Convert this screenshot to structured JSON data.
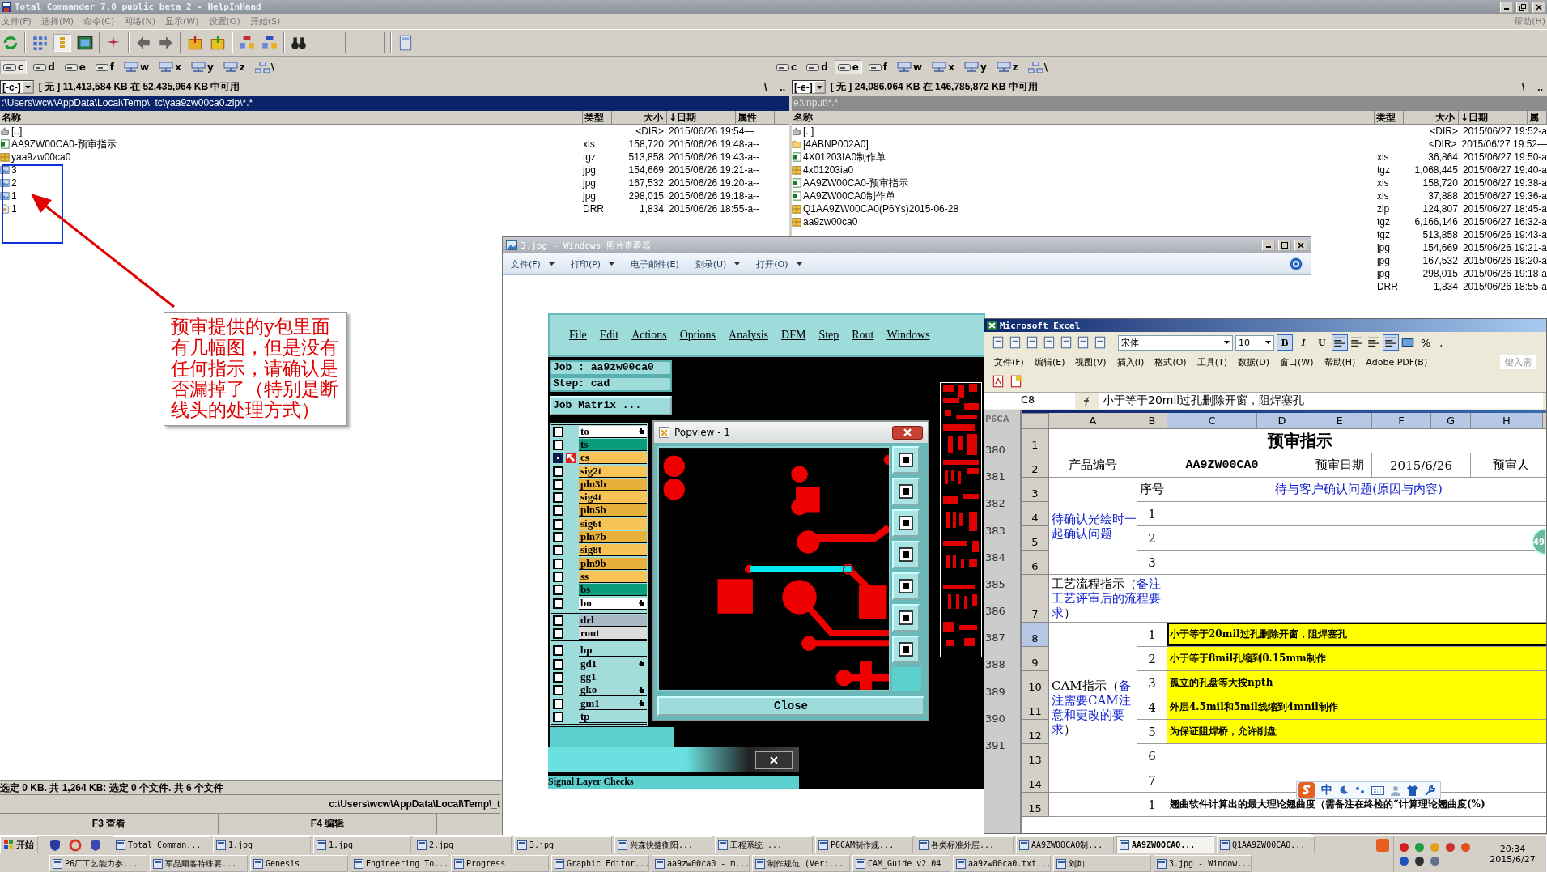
{
  "tc": {
    "title": "Total Commander 7.0 public beta 2 - HelpInHand",
    "menu": [
      "文件(F)",
      "选择(M)",
      "命令(C)",
      "网络(N)",
      "显示(W)",
      "设置(O)",
      "开始(S)"
    ],
    "help_menu": "帮助(H)",
    "drives_left": [
      {
        "letter": "c",
        "kind": "disk",
        "selected": true
      },
      {
        "letter": "d",
        "kind": "disk",
        "selected": false
      },
      {
        "letter": "e",
        "kind": "disk",
        "selected": false
      },
      {
        "letter": "f",
        "kind": "disk",
        "selected": false
      },
      {
        "letter": "w",
        "kind": "network",
        "selected": false
      },
      {
        "letter": "x",
        "kind": "network",
        "selected": false
      },
      {
        "letter": "y",
        "kind": "network",
        "selected": false
      },
      {
        "letter": "z",
        "kind": "network",
        "selected": false
      },
      {
        "letter": "\\",
        "kind": "root",
        "selected": false
      }
    ],
    "drives_right": [
      {
        "letter": "c",
        "kind": "disk",
        "selected": false
      },
      {
        "letter": "d",
        "kind": "disk",
        "selected": false
      },
      {
        "letter": "e",
        "kind": "disk",
        "selected": true
      },
      {
        "letter": "f",
        "kind": "disk",
        "selected": false
      },
      {
        "letter": "w",
        "kind": "network",
        "selected": false
      },
      {
        "letter": "x",
        "kind": "network",
        "selected": false
      },
      {
        "letter": "y",
        "kind": "network",
        "selected": false
      },
      {
        "letter": "z",
        "kind": "network",
        "selected": false
      },
      {
        "letter": "\\",
        "kind": "root",
        "selected": false
      }
    ],
    "left_panel": {
      "drive": "[-c-]",
      "free": "[ 无 ]  11,413,584 KB 在 52,435,964 KB 中可用",
      "root_button": "\\",
      "up_button": "..",
      "path": ":\\Users\\wcw\\AppData\\Local\\Temp\\_tc\\yaa9zw00ca0.zip\\*.*",
      "active": true,
      "columns": [
        "名称",
        "类型",
        "大小",
        "↓日期",
        "属性"
      ],
      "rows": [
        {
          "kind": "up",
          "name": "[..]",
          "size": "<DIR>",
          "date": "2015/06/26 19:54—"
        },
        {
          "kind": "xls",
          "name": "AA9ZW00CA0-预审指示",
          "type": "xls",
          "size": "158,720",
          "date": "2015/06/26 19:48-a--"
        },
        {
          "kind": "archive",
          "name": "yaa9zw00ca0",
          "type": "tgz",
          "size": "513,858",
          "date": "2015/06/26 19:43-a--"
        },
        {
          "kind": "image",
          "name": "3",
          "type": "jpg",
          "size": "154,669",
          "date": "2015/06/26 19:21-a--"
        },
        {
          "kind": "image",
          "name": "2",
          "type": "jpg",
          "size": "167,532",
          "date": "2015/06/26 19:20-a--"
        },
        {
          "kind": "image",
          "name": "1",
          "type": "jpg",
          "size": "298,015",
          "date": "2015/06/26 19:18-a--"
        },
        {
          "kind": "file",
          "name": "1",
          "type": "DRR",
          "size": "1,834",
          "date": "2015/06/26 18:55-a--"
        }
      ]
    },
    "right_panel": {
      "drive": "[-e-]",
      "free": "[ 无 ]  24,086,064 KB 在 146,785,872 KB 中可用",
      "root_button": "\\",
      "up_button": "..",
      "path": "e:\\input\\*.*",
      "active": false,
      "columns": [
        "名称",
        "类型",
        "大小",
        "↓日期",
        "属"
      ],
      "rows": [
        {
          "kind": "up",
          "name": "[..]",
          "size": "<DIR>",
          "date": "2015/06/27 19:52-a"
        },
        {
          "kind": "folder",
          "name": "[4ABNP002A0]",
          "size": "<DIR>",
          "date": "2015/06/27 19:52—"
        },
        {
          "kind": "xls",
          "name": "4X01203IA0制作单",
          "type": "xls",
          "size": "36,864",
          "date": "2015/06/27 19:50-a"
        },
        {
          "kind": "archive",
          "name": "4x01203ia0",
          "type": "tgz",
          "size": "1,068,445",
          "date": "2015/06/27 19:40-a"
        },
        {
          "kind": "xls",
          "name": "AA9ZW00CA0-预审指示",
          "type": "xls",
          "size": "158,720",
          "date": "2015/06/27 19:38-a"
        },
        {
          "kind": "xls",
          "name": "AA9ZW00CA0制作单",
          "type": "xls",
          "size": "37,888",
          "date": "2015/06/27 19:36-a"
        },
        {
          "kind": "archive",
          "name": "Q1AA9ZW00CA0(P6Ys)2015-06-28",
          "type": "zip",
          "size": "124,807",
          "date": "2015/06/27 18:45-a"
        },
        {
          "kind": "archive",
          "name": "aa9zw00ca0",
          "type": "tgz",
          "size": "6,166,146",
          "date": "2015/06/27 16:32-a"
        },
        {
          "type": "tgz",
          "size": "513,858",
          "date": "2015/06/26 19:43-a"
        },
        {
          "type": "jpg",
          "size": "154,669",
          "date": "2015/06/26 19:21-a"
        },
        {
          "type": "jpg",
          "size": "167,532",
          "date": "2015/06/26 19:20-a"
        },
        {
          "type": "jpg",
          "size": "298,015",
          "date": "2015/06/26 19:18-a"
        },
        {
          "type": "DRR",
          "size": "1,834",
          "date": "2015/06/26 18:55-a"
        }
      ]
    },
    "status": "选定 0 KB. 共 1,264 KB: 选定 0 个文件. 共 6 个文件",
    "command_path": "c:\\Users\\wcw\\AppData\\Local\\Temp\\_t",
    "function_keys": [
      "F3 查看",
      "F4 编辑"
    ]
  },
  "annotation": {
    "text": "预审提供的y包里面有几幅图，但是没有任何指示，请确认是否漏掉了（特别是断线头的处理方式）"
  },
  "viewer": {
    "title": "3.jpg - Windows 照片查看器",
    "menu": [
      {
        "label": "文件(F)",
        "dropdown": true
      },
      {
        "label": "打印(P)",
        "dropdown": true
      },
      {
        "label": "电子邮件(E)",
        "dropdown": false
      },
      {
        "label": "刻录(U)",
        "dropdown": true
      },
      {
        "label": "打开(O)",
        "dropdown": true
      }
    ],
    "genesis": {
      "menu": [
        "File",
        "Edit",
        "Actions",
        "Options",
        "Analysis",
        "DFM",
        "Step",
        "Rout",
        "Windows"
      ],
      "job": "Job : aa9zw00ca0",
      "step": "Step: cad",
      "matrix_button": "Job Matrix ...",
      "layer_groups": [
        {
          "layers": [
            {
              "name": "to",
              "color": "#ffffff",
              "selected": false,
              "pinned": true
            },
            {
              "name": "ts",
              "color": "#0b9c7c",
              "selected": false,
              "pinned": false
            },
            {
              "name": "cs",
              "color": "#f8c458",
              "selected": true,
              "pinned": false
            },
            {
              "name": "sig2t",
              "color": "#f8c458",
              "selected": false,
              "pinned": false
            },
            {
              "name": "pln3b",
              "color": "#e8b038",
              "selected": false,
              "pinned": false
            },
            {
              "name": "sig4t",
              "color": "#f8c458",
              "selected": false,
              "pinned": false
            },
            {
              "name": "pln5b",
              "color": "#e8b038",
              "selected": false,
              "pinned": false
            },
            {
              "name": "sig6t",
              "color": "#f8c458",
              "selected": false,
              "pinned": false
            },
            {
              "name": "pln7b",
              "color": "#e8b038",
              "selected": false,
              "pinned": false
            },
            {
              "name": "sig8t",
              "color": "#f8c458",
              "selected": false,
              "pinned": false
            },
            {
              "name": "pln9b",
              "color": "#e8b038",
              "selected": false,
              "pinned": false
            },
            {
              "name": "ss",
              "color": "#f8c458",
              "selected": false,
              "pinned": false
            },
            {
              "name": "bs",
              "color": "#0b9c7c",
              "selected": false,
              "pinned": false
            },
            {
              "name": "bo",
              "color": "#ffffff",
              "selected": false,
              "pinned": true
            }
          ]
        },
        {
          "layers": [
            {
              "name": "drl",
              "color": "#a8b8c4",
              "selected": false,
              "pinned": false
            },
            {
              "name": "rout",
              "color": "#dcdcdc",
              "selected": false,
              "pinned": false
            }
          ]
        },
        {
          "layers": [
            {
              "name": "bp",
              "color": "#a4dcdc",
              "selected": false,
              "pinned": false
            },
            {
              "name": "gd1",
              "color": "#a4dcdc",
              "selected": false,
              "pinned": true
            },
            {
              "name": "gg1",
              "color": "#a4dcdc",
              "selected": false,
              "pinned": false
            },
            {
              "name": "gko",
              "color": "#a4dcdc",
              "selected": false,
              "pinned": true
            },
            {
              "name": "gm1",
              "color": "#a4dcdc",
              "selected": false,
              "pinned": true
            },
            {
              "name": "tp",
              "color": "#a4dcdc",
              "selected": false,
              "pinned": false
            }
          ]
        }
      ],
      "popview": {
        "title": "Popview - 1",
        "close_button": "Close"
      },
      "dialog_title": "Signal Layer Checks"
    }
  },
  "excel": {
    "title": "Microsoft Excel",
    "font": "宋体",
    "font_size": "10",
    "format_buttons": [
      {
        "label": "B",
        "selected": true
      },
      {
        "label": "I",
        "selected": false
      },
      {
        "label": "U",
        "selected": false
      }
    ],
    "number_buttons": [
      "%",
      ","
    ],
    "menu": [
      "文件(F)",
      "编辑(E)",
      "视图(V)",
      "插入(I)",
      "格式(O)",
      "工具(T)",
      "数据(D)",
      "窗口(W)",
      "帮助(H)",
      "Adobe PDF(B)"
    ],
    "help_box": "键入需",
    "cell_ref": "C8",
    "formula": "小于等于20mil过孔删除开窗，阻焊塞孔",
    "side_window": {
      "title": "P6CA",
      "numbers": [
        "380",
        "381",
        "382",
        "383",
        "384",
        "385",
        "386",
        "387",
        "388",
        "389",
        "390",
        "391"
      ]
    },
    "badge": "49",
    "sheet": {
      "columns": [
        {
          "label": "A",
          "selected": false
        },
        {
          "label": "B",
          "selected": false
        },
        {
          "label": "C",
          "selected": true
        },
        {
          "label": "D",
          "selected": true
        },
        {
          "label": "E",
          "selected": true
        },
        {
          "label": "F",
          "selected": true
        },
        {
          "label": "G",
          "selected": true
        },
        {
          "label": "H",
          "selected": true
        }
      ],
      "rows": [
        {
          "label": "1",
          "selected": false
        },
        {
          "label": "2",
          "selected": false
        },
        {
          "label": "3",
          "selected": false
        },
        {
          "label": "4",
          "selected": false
        },
        {
          "label": "5",
          "selected": false
        },
        {
          "label": "6",
          "selected": false
        },
        {
          "label": "7",
          "selected": false
        },
        {
          "label": "8",
          "selected": true
        },
        {
          "label": "9",
          "selected": false
        },
        {
          "label": "10",
          "selected": false
        },
        {
          "label": "11",
          "selected": false
        },
        {
          "label": "12",
          "selected": false
        },
        {
          "label": "13",
          "selected": false
        },
        {
          "label": "14",
          "selected": false
        },
        {
          "label": "15",
          "selected": false
        }
      ],
      "title": "预审指示",
      "product_label": "产品编号",
      "product": "AA9ZW00CA0",
      "date_label": "预审日期",
      "date": "2015/6/26",
      "reviewer_label": "预审人",
      "confirm": {
        "label": "待确认光绘时一起确认问题",
        "seq_label": "序号",
        "heading": "待与客户确认问题(原因与内容)",
        "items": [
          "1",
          "2",
          "3"
        ]
      },
      "process": {
        "lead": "工艺流程指示（",
        "note": "备注工艺评审后的流程要求",
        "tail": "）"
      },
      "cam": {
        "lead": "CAM指示（",
        "note": "备注需要CAM注意和更改的要求",
        "tail": "）",
        "items": [
          {
            "no": "1",
            "text": "小于等于20mil过孔删除开窗，阻焊塞孔",
            "highlight": true,
            "selected": true
          },
          {
            "no": "2",
            "text": "小于等于8mil孔缩到0.15mm制作",
            "highlight": true,
            "selected": false
          },
          {
            "no": "3",
            "text": "孤立的孔盘等大按npth",
            "highlight": true,
            "selected": false
          },
          {
            "no": "4",
            "text": "外层4.5mil和5mil线缩到4mnil制作",
            "highlight": true,
            "selected": false
          },
          {
            "no": "5",
            "text": "为保证阻焊桥，允许削盘",
            "highlight": true,
            "selected": false
          },
          {
            "no": "6",
            "highlight": false,
            "selected": false
          },
          {
            "no": "7",
            "highlight": false,
            "selected": false
          }
        ]
      },
      "next": {
        "no": "1",
        "text": "翘曲软件计算出的最大理论翘曲度（需备注在终检的“计算理论翘曲度(%)"
      }
    }
  },
  "ime": {
    "mode": "中"
  },
  "taskbar": {
    "start": "开始",
    "row1": [
      {
        "label": "Total Comman...",
        "selected": false
      },
      {
        "label": "1.jpg",
        "selected": false
      },
      {
        "label": "1.jpg",
        "selected": false
      },
      {
        "label": "2.jpg",
        "selected": false
      },
      {
        "label": "3.jpg",
        "selected": false
      },
      {
        "label": "兴森快捷衡阳...",
        "selected": false
      },
      {
        "label": "工程系统    ...",
        "selected": false
      },
      {
        "label": "P6CAM制作规...",
        "selected": false
      },
      {
        "label": "各类标准外层...",
        "selected": false
      },
      {
        "label": "AA9ZWOOCAO制...",
        "selected": false
      },
      {
        "label": "AA9ZWOOCAO...",
        "selected": true
      },
      {
        "label": "Q1AA9ZW00CAO...",
        "selected": false
      }
    ],
    "row2": [
      {
        "label": "P6厂工艺能力参...",
        "selected": false
      },
      {
        "label": "军品顾客特殊要...",
        "selected": false
      },
      {
        "label": "Genesis",
        "selected": false
      },
      {
        "label": "Engineering To...",
        "selected": false
      },
      {
        "label": "Progress",
        "selected": false
      },
      {
        "label": "Graphic Editor...",
        "selected": false
      },
      {
        "label": "aa9zw00ca0 - m...",
        "selected": false
      },
      {
        "label": "制作规范 (Ver:...",
        "selected": false
      },
      {
        "label": "CAM_Guide v2.04",
        "selected": false
      },
      {
        "label": "aa9zw00ca0.txt...",
        "selected": false
      },
      {
        "label": "刘灿",
        "selected": false
      },
      {
        "label": "3.jpg - Window...",
        "selected": false
      }
    ],
    "time": "20:34",
    "date": "2015/6/27"
  }
}
